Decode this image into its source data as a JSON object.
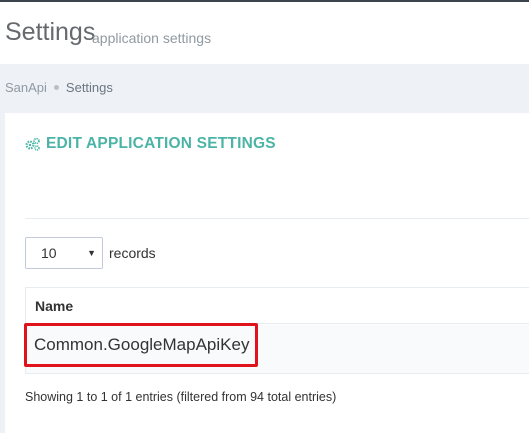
{
  "header": {
    "title": "Settings",
    "subtitle": "application settings"
  },
  "breadcrumb": {
    "items": [
      "SanApi",
      "Settings"
    ]
  },
  "portlet": {
    "title": "EDIT APPLICATION SETTINGS",
    "title_icon": "gears-icon",
    "accent_color": "#4bb4a6"
  },
  "table_controls": {
    "page_length_value": "10",
    "page_length_suffix": "records"
  },
  "table": {
    "columns": [
      "Name"
    ],
    "rows": [
      [
        "Common.GoogleMapApiKey"
      ]
    ],
    "highlight_color": "#e0131c"
  },
  "table_info": "Showing 1 to 1 of 1 entries (filtered from 94 total entries)"
}
